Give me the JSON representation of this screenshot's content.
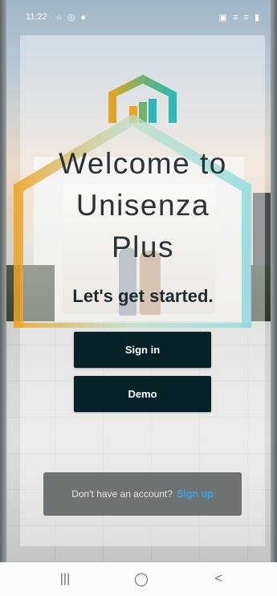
{
  "status_bar": {
    "time": "11:22",
    "left_icons": "○ ◎ ●",
    "right_icons": "▣ ≡ ≡ ▮"
  },
  "welcome": {
    "title_line1": "Welcome to",
    "title_line2": "Unisenza",
    "title_line3": "Plus",
    "tagline": "Let's get started."
  },
  "buttons": {
    "sign_in": "Sign in",
    "demo": "Demo"
  },
  "signup": {
    "prompt": "Don't have an account?",
    "link": "Sign up"
  },
  "nav": {
    "recent": "|||",
    "home": "◯",
    "back": "<"
  },
  "colors": {
    "button_bg": "#082327",
    "link": "#3da1e0",
    "logo_orange": "#f0a21e",
    "logo_teal": "#28b9bd",
    "logo_green": "#6fb46a"
  }
}
